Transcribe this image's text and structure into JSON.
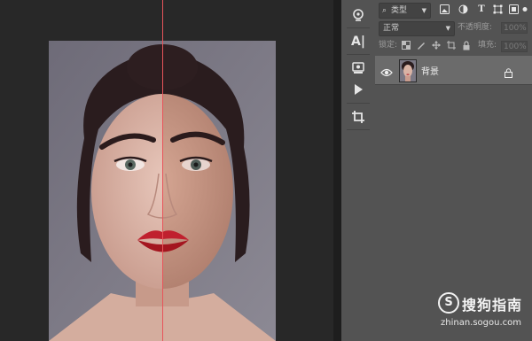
{
  "layers_panel": {
    "filter": {
      "icon": "search-icon",
      "label": "类型"
    },
    "filter_icons": [
      "image-filter-icon",
      "adjustment-filter-icon",
      "type-filter-icon",
      "shape-filter-icon",
      "smart-object-filter-icon"
    ],
    "blend_mode": "正常",
    "opacity_label": "不透明度:",
    "opacity_value": "100%",
    "lock_label": "锁定:",
    "fill_label": "填充:",
    "fill_value": "100%",
    "layers": [
      {
        "name": "背景",
        "visible": true,
        "locked": true
      }
    ]
  },
  "tools": [
    "history-brush-icon",
    "character-icon",
    "properties-icon",
    "play-action-icon",
    "crop-icon"
  ],
  "type_filter_glyph": "T",
  "character_glyph": "A|",
  "watermark": {
    "brand": "搜狗指南",
    "url": "zhinan.sogou.com",
    "logo_glyph": "S"
  },
  "colors": {
    "guide": "#e8545a",
    "canvas_bg": "#282828",
    "panel_bg": "#535353",
    "selected_layer": "#6b6b6b"
  }
}
